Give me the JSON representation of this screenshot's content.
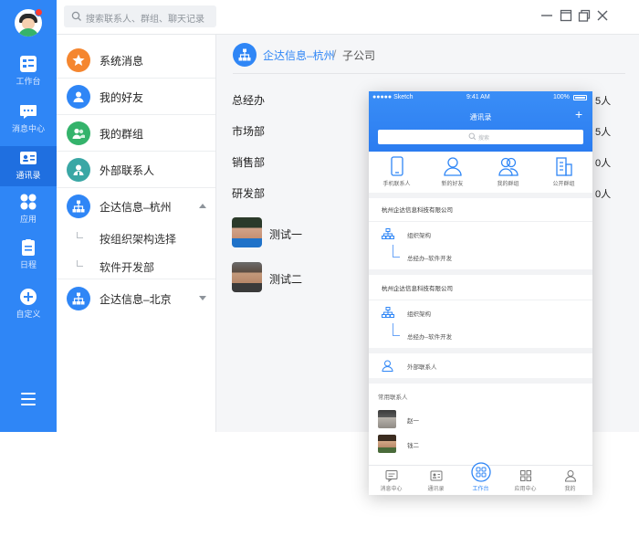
{
  "rail": {
    "items": [
      {
        "label": "工作台",
        "icon": "workbench-icon"
      },
      {
        "label": "消息中心",
        "icon": "message-icon"
      },
      {
        "label": "通讯录",
        "icon": "contacts-icon",
        "active": true
      },
      {
        "label": "应用",
        "icon": "apps-icon"
      },
      {
        "label": "日程",
        "icon": "calendar-icon"
      },
      {
        "label": "自定义",
        "icon": "add-circle-icon"
      }
    ]
  },
  "search": {
    "placeholder": "搜索联系人、群组、聊天记录"
  },
  "contacts": {
    "items": [
      {
        "label": "系统消息",
        "color": "#f5862f"
      },
      {
        "label": "我的好友",
        "color": "#2f86f6"
      },
      {
        "label": "我的群组",
        "color": "#34b36b"
      },
      {
        "label": "外部联系人",
        "color": "#3aa7a5"
      },
      {
        "label": "企达信息–杭州",
        "color": "#2f86f6"
      }
    ],
    "subitems": [
      "按组织架构选择",
      "软件开发部"
    ],
    "last": {
      "label": "企达信息–北京",
      "color": "#2f86f6"
    }
  },
  "breadcrumb": {
    "main": "企达信息–杭州",
    "sep": "/",
    "sub": "子公司"
  },
  "departments": [
    {
      "name": "总经办",
      "count": "5人"
    },
    {
      "name": "市场部",
      "count": "5人"
    },
    {
      "name": "销售部",
      "count": "0人"
    },
    {
      "name": "研发部",
      "count": "0人"
    }
  ],
  "members": [
    {
      "name": "测试一"
    },
    {
      "name": "测试二"
    }
  ],
  "phone": {
    "carrier": "●●●●● Sketch",
    "time": "9:41 AM",
    "battery": "100%",
    "title": "通讯录",
    "plus": "+",
    "search_placeholder": "搜索",
    "quick": [
      "手机联系人",
      "新的好友",
      "我的群组",
      "公开群组"
    ],
    "org_blocks": [
      {
        "company": "杭州企达信息科技有限公司",
        "structure": "组织架构",
        "dept": "总经办–软件开发"
      },
      {
        "company": "杭州企达信息科技有限公司",
        "structure": "组织架构",
        "dept": "总经办–软件开发"
      }
    ],
    "external": "外部联系人",
    "frequent_title": "常用联系人",
    "frequent": [
      {
        "name": "赵一"
      },
      {
        "name": "钱二"
      }
    ],
    "tabs": [
      {
        "label": "消息中心"
      },
      {
        "label": "通讯录"
      },
      {
        "label": "工作台",
        "active": true
      },
      {
        "label": "应用中心"
      },
      {
        "label": "我的"
      }
    ]
  },
  "colors": {
    "brand": "#2f86f6",
    "rail": "#2f86f6",
    "active_rail": "#1f6fe0",
    "main_bg": "#f5f6f8"
  }
}
